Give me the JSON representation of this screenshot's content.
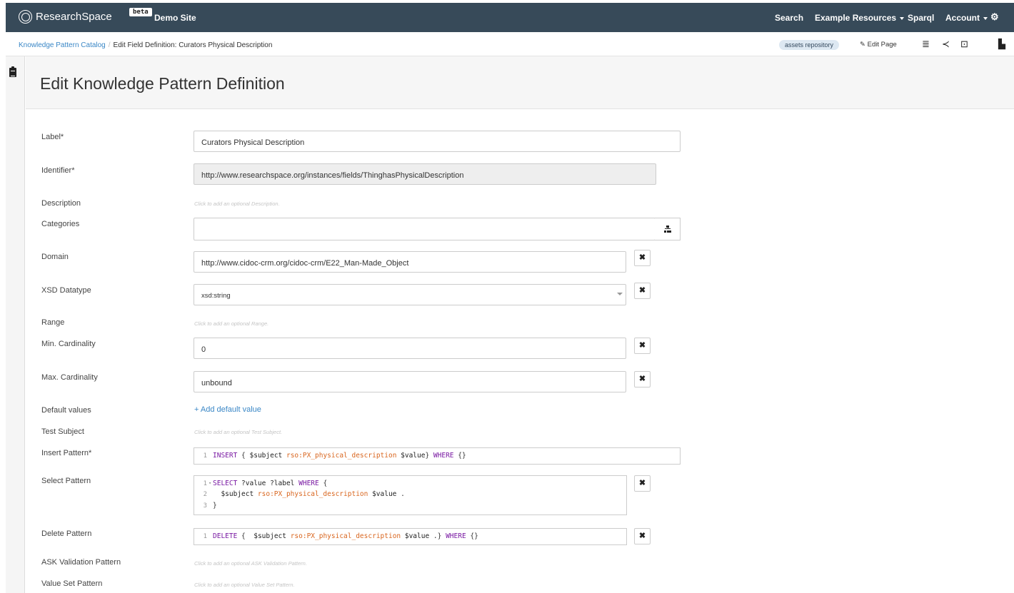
{
  "navbar": {
    "brand": "ResearchSpace",
    "beta": "beta",
    "site": "Demo Site",
    "items": [
      "Search",
      "Example Resources",
      "Sparql",
      "Account"
    ]
  },
  "breadcrumb": {
    "root": "Knowledge Pattern Catalog",
    "separator": "/",
    "current": "Edit Field Definition: Curators Physical Description"
  },
  "toolbar": {
    "repository": "assets repository",
    "edit_page": "Edit Page"
  },
  "page": {
    "title": "Edit Knowledge Pattern Definition"
  },
  "form": {
    "label": {
      "label": "Label*",
      "value": "Curators Physical Description"
    },
    "identifier": {
      "label": "Identifier*",
      "value": "http://www.researchspace.org/instances/fields/ThinghasPhysicalDescription"
    },
    "description": {
      "label": "Description",
      "placeholder": "Click to add an optional Description."
    },
    "categories": {
      "label": "Categories",
      "value": ""
    },
    "domain": {
      "label": "Domain",
      "value": "http://www.cidoc-crm.org/cidoc-crm/E22_Man-Made_Object"
    },
    "xsd_datatype": {
      "label": "XSD Datatype",
      "value": "xsd:string"
    },
    "range": {
      "label": "Range",
      "placeholder": "Click to add an optional Range."
    },
    "min_cardinality": {
      "label": "Min. Cardinality",
      "value": "0"
    },
    "max_cardinality": {
      "label": "Max. Cardinality",
      "value": "unbound"
    },
    "default_values": {
      "label": "Default values",
      "link": "+ Add default value"
    },
    "test_subject": {
      "label": "Test Subject",
      "placeholder": "Click to add an optional Test Subject."
    },
    "insert_pattern": {
      "label": "Insert Pattern*",
      "lines": [
        {
          "n": "1",
          "k1": "INSERT",
          "t1": " { ",
          "v1": "$subject",
          "p1": " rso:PX_physical_description",
          "v2": " $value",
          "t2": "} ",
          "k2": "WHERE",
          "t3": " {}"
        }
      ]
    },
    "select_pattern": {
      "label": "Select Pattern",
      "line1": {
        "n": "1",
        "k1": "SELECT",
        "v1": " ?value ?label ",
        "k2": "WHERE",
        "t1": " {"
      },
      "line2": {
        "n": "2",
        "v1": "  $subject",
        "p1": " rso:PX_physical_description",
        "v2": " $value",
        "t1": " ."
      },
      "line3": {
        "n": "3",
        "t1": "}"
      }
    },
    "delete_pattern": {
      "label": "Delete Pattern",
      "line1": {
        "n": "1",
        "k1": "DELETE",
        "t1": " {  ",
        "v1": "$subject",
        "p1": " rso:PX_physical_description",
        "v2": " $value",
        "t2": " .} ",
        "k2": "WHERE",
        "t3": " {}"
      }
    },
    "ask_validation": {
      "label": "ASK Validation Pattern",
      "placeholder": "Click to add an optional ASK Validation Pattern."
    },
    "value_set": {
      "label": "Value Set Pattern",
      "placeholder": "Click to add an optional Value Set Pattern."
    }
  }
}
